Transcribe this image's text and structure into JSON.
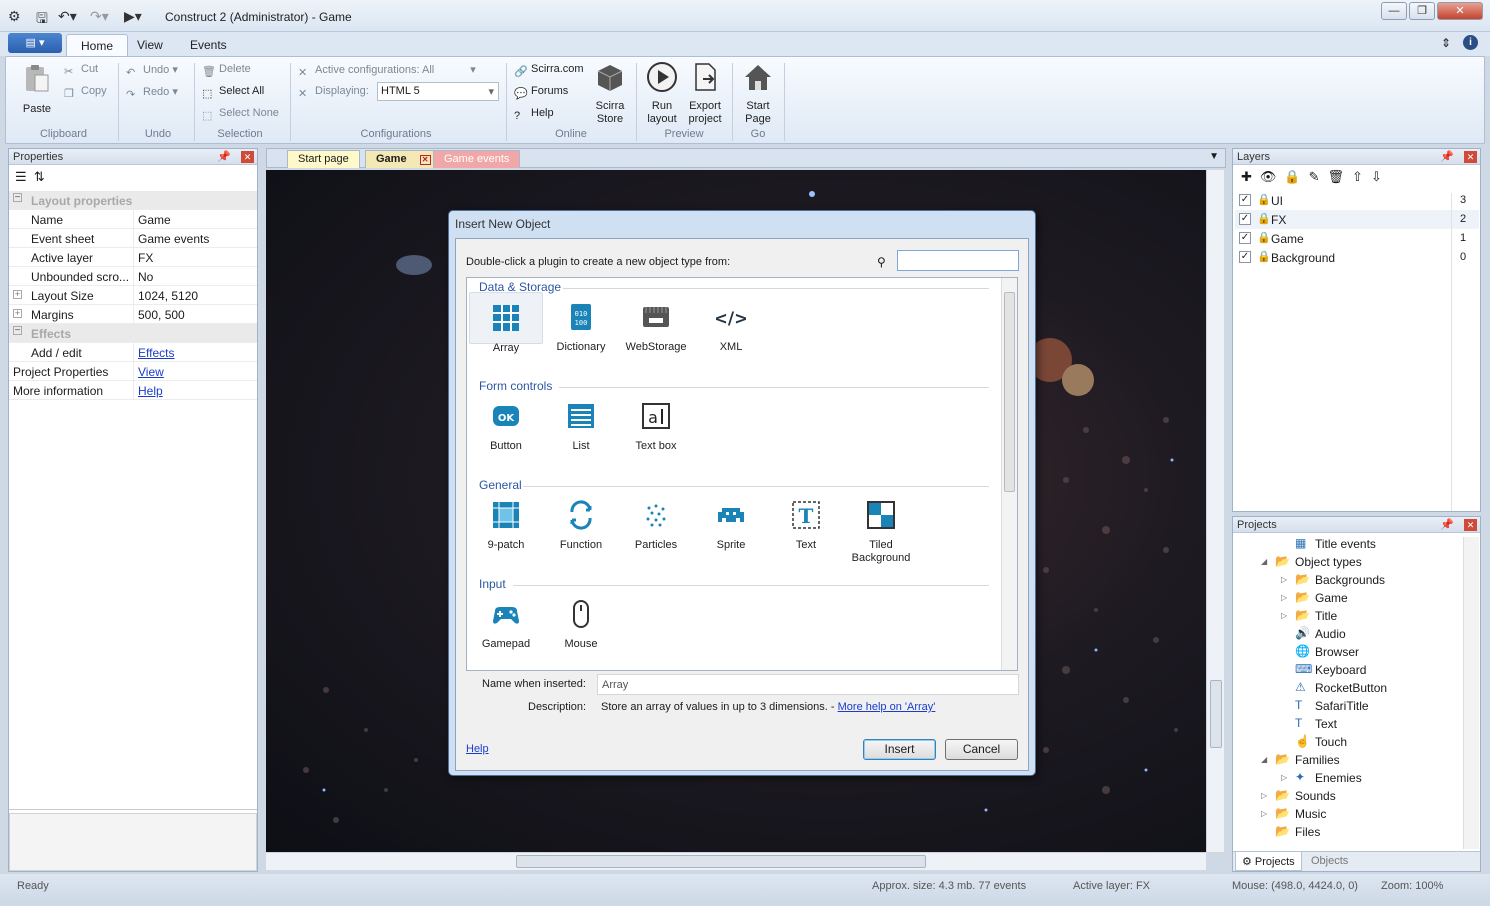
{
  "window": {
    "title": "Construct 2 (Administrator) - Game",
    "app_menu": "▤ ▾"
  },
  "ribbon": {
    "tabs": [
      "Home",
      "View",
      "Events"
    ],
    "clipboard": {
      "paste": "Paste",
      "cut": "Cut",
      "copy": "Copy",
      "label": "Clipboard"
    },
    "undo": {
      "undo": "Undo",
      "redo": "Redo",
      "label": "Undo"
    },
    "selection": {
      "delete": "Delete",
      "select_all": "Select All",
      "select_none": "Select None",
      "label": "Selection"
    },
    "configurations": {
      "active": "Active configurations: All",
      "displaying_label": "Displaying:",
      "displaying_value": "HTML 5",
      "label": "Configurations"
    },
    "online": {
      "scirra": "Scirra.com",
      "forums": "Forums",
      "help": "Help",
      "store_line1": "Scirra",
      "store_line2": "Store",
      "label": "Online"
    },
    "preview": {
      "run_line1": "Run",
      "run_line2": "layout",
      "export_line1": "Export",
      "export_line2": "project",
      "label": "Preview"
    },
    "go": {
      "start_line1": "Start",
      "start_line2": "Page",
      "label": "Go"
    }
  },
  "properties": {
    "title": "Properties",
    "rows": [
      {
        "k": "Layout properties",
        "v": "",
        "type": "cat"
      },
      {
        "k": "Name",
        "v": "Game"
      },
      {
        "k": "Event sheet",
        "v": "Game events"
      },
      {
        "k": "Active layer",
        "v": "FX"
      },
      {
        "k": "Unbounded scro...",
        "v": "No"
      },
      {
        "k": "Layout Size",
        "v": "1024, 5120",
        "expand": true
      },
      {
        "k": "Margins",
        "v": "500, 500",
        "expand": true
      },
      {
        "k": "Effects",
        "v": "",
        "type": "cat"
      },
      {
        "k": "Add / edit",
        "v": "Effects",
        "link": true
      },
      {
        "k": "Project Properties",
        "v": "View",
        "link": true,
        "top": true
      },
      {
        "k": "More information",
        "v": "Help",
        "link": true,
        "top": true
      }
    ]
  },
  "doc_tabs": [
    "Start page",
    "Game",
    "Game events"
  ],
  "dialog": {
    "title": "Insert New Object",
    "prompt": "Double-click a plugin to create a new object type from:",
    "search_value": "",
    "categories": [
      {
        "name": "Data & Storage",
        "plugins": [
          {
            "n": "Array",
            "i": "grid"
          },
          {
            "n": "Dictionary",
            "i": "dict"
          },
          {
            "n": "WebStorage",
            "i": "storage"
          },
          {
            "n": "XML",
            "i": "xml"
          }
        ]
      },
      {
        "name": "Form controls",
        "plugins": [
          {
            "n": "Button",
            "i": "ok"
          },
          {
            "n": "List",
            "i": "list"
          },
          {
            "n": "Text box",
            "i": "textbox"
          }
        ]
      },
      {
        "name": "General",
        "plugins": [
          {
            "n": "9-patch",
            "i": "ninepatch"
          },
          {
            "n": "Function",
            "i": "func"
          },
          {
            "n": "Particles",
            "i": "particles"
          },
          {
            "n": "Sprite",
            "i": "sprite"
          },
          {
            "n": "Text",
            "i": "text"
          },
          {
            "n": "Tiled\nBackground",
            "i": "tiled"
          }
        ]
      },
      {
        "name": "Input",
        "plugins": [
          {
            "n": "Gamepad",
            "i": "gamepad"
          },
          {
            "n": "Mouse",
            "i": "mouse"
          }
        ]
      }
    ],
    "name_label": "Name when inserted:",
    "name_value": "Array",
    "desc_label": "Description:",
    "desc_text": "Store an array of values in up to 3 dimensions. - ",
    "desc_link": "More help on 'Array'",
    "help": "Help",
    "insert": "Insert",
    "cancel": "Cancel"
  },
  "layers": {
    "title": "Layers",
    "rows": [
      {
        "name": "UI",
        "n": "3",
        "locked": false
      },
      {
        "name": "FX",
        "n": "2",
        "locked": false
      },
      {
        "name": "Game",
        "n": "1",
        "locked": false
      },
      {
        "name": "Background",
        "n": "0",
        "locked": true
      }
    ]
  },
  "projects": {
    "title": "Projects",
    "tree": [
      {
        "t": "Title events",
        "d": 3,
        "i": "sheet"
      },
      {
        "t": "Object types",
        "d": 2,
        "i": "folder",
        "open": true
      },
      {
        "t": "Backgrounds",
        "d": 3,
        "i": "folder",
        "exp": true
      },
      {
        "t": "Game",
        "d": 3,
        "i": "folder",
        "exp": true
      },
      {
        "t": "Title",
        "d": 3,
        "i": "folder",
        "exp": true
      },
      {
        "t": "Audio",
        "d": 3,
        "i": "audio"
      },
      {
        "t": "Browser",
        "d": 3,
        "i": "globe"
      },
      {
        "t": "Keyboard",
        "d": 3,
        "i": "keyboard"
      },
      {
        "t": "RocketButton",
        "d": 3,
        "i": "warn"
      },
      {
        "t": "SafariTitle",
        "d": 3,
        "i": "text"
      },
      {
        "t": "Text",
        "d": 3,
        "i": "text"
      },
      {
        "t": "Touch",
        "d": 3,
        "i": "touch"
      },
      {
        "t": "Families",
        "d": 2,
        "i": "folder",
        "open": true
      },
      {
        "t": "Enemies",
        "d": 3,
        "i": "family",
        "exp": true
      },
      {
        "t": "Sounds",
        "d": 2,
        "i": "folder",
        "exp": true
      },
      {
        "t": "Music",
        "d": 2,
        "i": "folder",
        "exp": true
      },
      {
        "t": "Files",
        "d": 2,
        "i": "folder"
      }
    ],
    "tabs": [
      "Projects",
      "Objects"
    ]
  },
  "status": {
    "left": "Ready",
    "size": "Approx. size: 4.3 mb. 77 events",
    "layer": "Active layer: FX",
    "mouse": "Mouse: (498.0, 4424.0, 0)",
    "zoom": "Zoom: 100%"
  },
  "colors": {
    "accent": "#2c56a5",
    "plugin_icon": "#1a84b8",
    "link": "#1a3ccc"
  }
}
